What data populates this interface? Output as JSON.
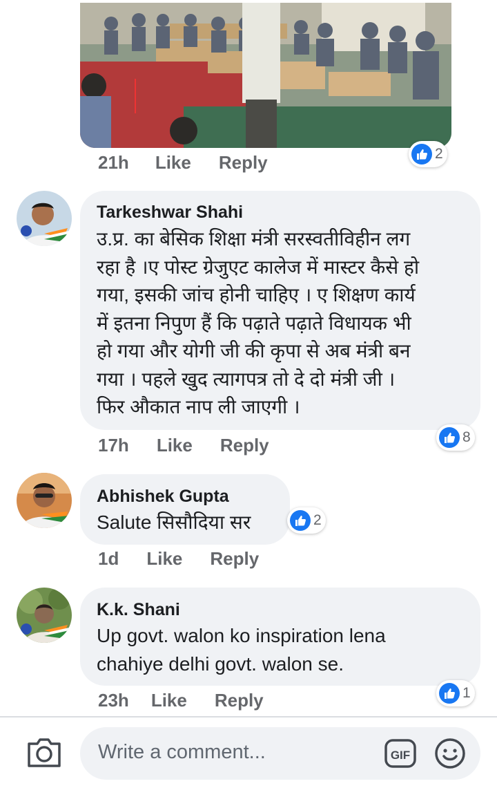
{
  "colors": {
    "accent": "#1877f2",
    "bubble": "#f0f2f5",
    "meta": "#65676b"
  },
  "top_post": {
    "time": "21h",
    "like": "Like",
    "reply": "Reply",
    "reactions": "2"
  },
  "comments": [
    {
      "author": "Tarkeshwar Shahi",
      "lines": [
        "उ.प्र. का बेसिक शिक्षा मंत्री सरस्वतीविहीन लग",
        "रहा है ।ए पोस्ट ग्रेजुएट कालेज में मास्टर कैसे हो",
        "गया, इसकी जांच होनी चाहिए । ए शिक्षण कार्य",
        "में इतना निपुण हैं कि पढ़ाते पढ़ाते विधायक भी",
        "हो गया और योगी जी की कृपा से अब मंत्री बन",
        "गया । पहले खुद त्यागपत्र तो दे दो मंत्री जी ।",
        "फिर औकात नाप ली जाएगी ।"
      ],
      "time": "17h",
      "like": "Like",
      "reply": "Reply",
      "reactions": "8"
    },
    {
      "author": "Abhishek Gupta",
      "lines": [
        "Salute सिसौदिया सर"
      ],
      "time": "1d",
      "like": "Like",
      "reply": "Reply",
      "reactions": "2"
    },
    {
      "author": "K.k. Shani",
      "lines": [
        "Up govt. walon ko inspiration lena",
        "chahiye delhi govt. walon se."
      ],
      "time": "23h",
      "like": "Like",
      "reply": "Reply",
      "reactions": "1"
    }
  ],
  "composer": {
    "placeholder": "Write a comment...",
    "gif_label": "GIF"
  },
  "icons": [
    "camera-icon",
    "gif-icon",
    "smile-icon",
    "like-icon"
  ]
}
